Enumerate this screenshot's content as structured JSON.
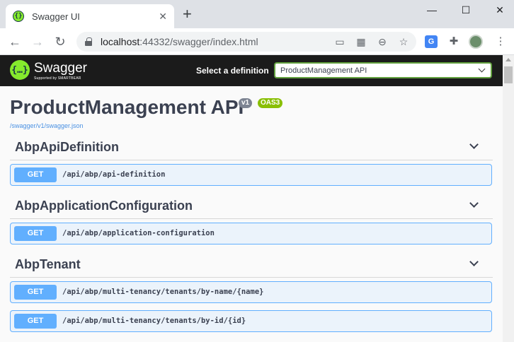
{
  "browser": {
    "tab_title": "Swagger UI",
    "url_host": "localhost",
    "url_rest": ":44332/swagger/index.html"
  },
  "swagger": {
    "brand": "Swagger",
    "brand_sub": "Supported by SMARTBEAR",
    "select_label": "Select a definition",
    "selected_definition": "ProductManagement API",
    "api_title": "ProductManagement API",
    "version_badge": "v1",
    "oas_badge": "OAS3",
    "spec_link": "/swagger/v1/swagger.json"
  },
  "sections": [
    {
      "title": "AbpApiDefinition",
      "operations": [
        {
          "method": "GET",
          "path": "/api/abp/api-definition"
        }
      ]
    },
    {
      "title": "AbpApplicationConfiguration",
      "operations": [
        {
          "method": "GET",
          "path": "/api/abp/application-configuration"
        }
      ]
    },
    {
      "title": "AbpTenant",
      "operations": [
        {
          "method": "GET",
          "path": "/api/abp/multi-tenancy/tenants/by-name/{name}"
        },
        {
          "method": "GET",
          "path": "/api/abp/multi-tenancy/tenants/by-id/{id}"
        }
      ]
    }
  ],
  "colors": {
    "get_accent": "#61affe",
    "swagger_green": "#85ea2d",
    "topbar_bg": "#1b1b1b"
  }
}
